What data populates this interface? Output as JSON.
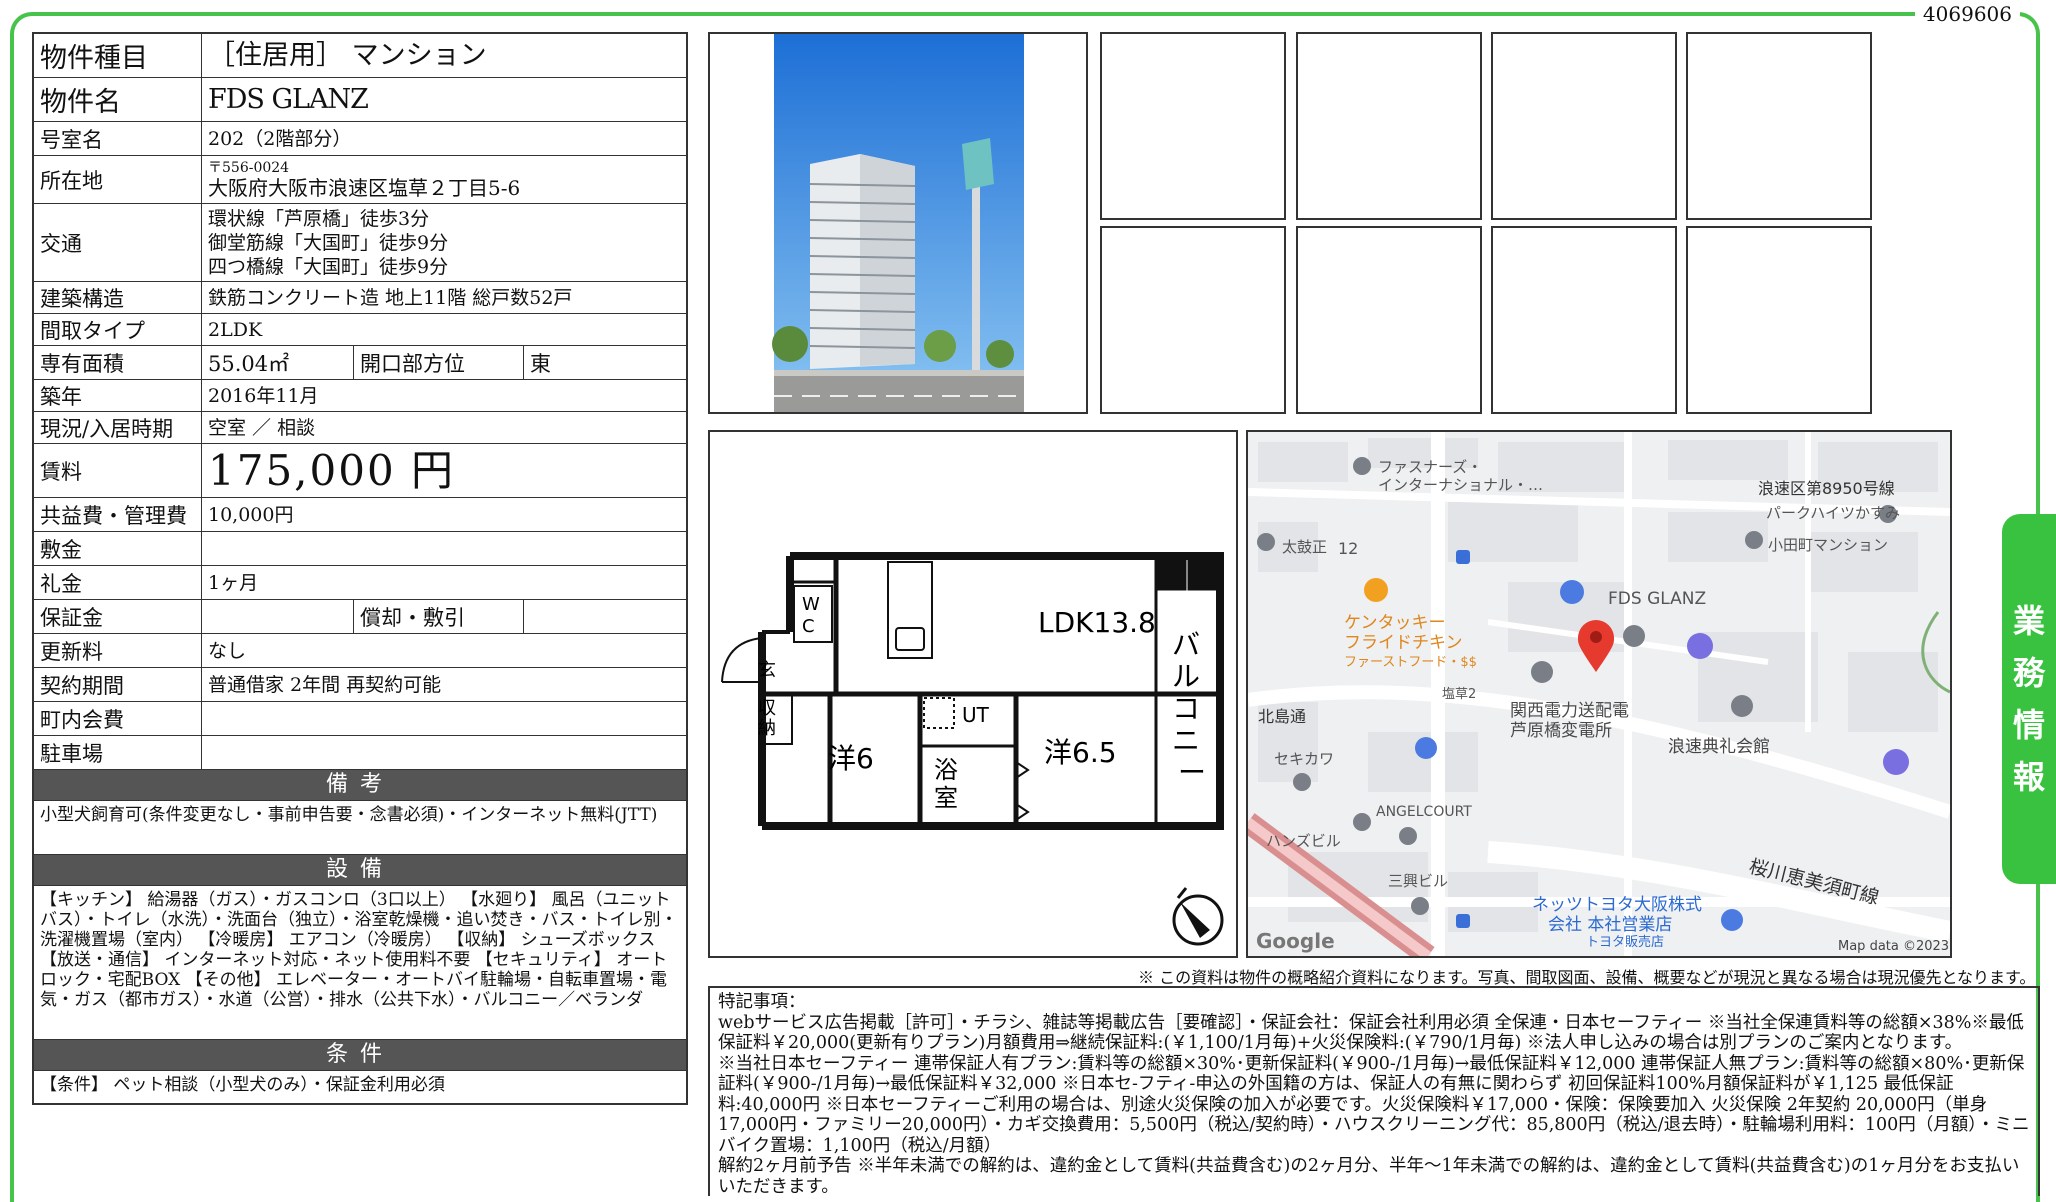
{
  "doc_id": "4069606",
  "side_tab": "業務情報",
  "property": {
    "rows": [
      {
        "label": "物件種目",
        "value": "［住居用］ マンション",
        "size": "big"
      },
      {
        "label": "物件名",
        "value": "FDS GLANZ",
        "size": "big"
      },
      {
        "label": "号室名",
        "value": "202（2階部分）"
      },
      {
        "label": "所在地",
        "postal": "〒556-0024",
        "value": "大阪府大阪市浪速区塩草２丁目5-6"
      },
      {
        "label": "交通",
        "lines": [
          "環状線「芦原橋」徒歩3分",
          "御堂筋線「大国町」徒歩9分",
          "四つ橋線「大国町」徒歩9分"
        ]
      },
      {
        "label": "建築構造",
        "value": "鉄筋コンクリート造 地上11階 総戸数52戸"
      },
      {
        "label": "間取タイプ",
        "value": "2LDK"
      },
      {
        "label": "専有面積",
        "value": "55.04㎡",
        "sub_label": "開口部方位",
        "sub_value": "東"
      },
      {
        "label": "築年",
        "value": "2016年11月"
      },
      {
        "label": "現況/入居時期",
        "value": "空室 ／ 相談"
      },
      {
        "label": "賃料",
        "value": "175,000 円",
        "size": "rent"
      },
      {
        "label": "共益費・管理費",
        "value": "10,000円"
      },
      {
        "label": "敷金",
        "value": ""
      },
      {
        "label": "礼金",
        "value": "1ヶ月"
      },
      {
        "label": "保証金",
        "value": "",
        "sub_label": "償却・敷引",
        "sub_value": ""
      },
      {
        "label": "更新料",
        "value": "なし"
      },
      {
        "label": "契約期間",
        "value": "普通借家 2年間 再契約可能"
      },
      {
        "label": "町内会費",
        "value": ""
      },
      {
        "label": "駐車場",
        "value": ""
      }
    ],
    "remarks_header": "備考",
    "remarks": "小型犬飼育可(条件変更なし・事前申告要・念書必須)・インターネット無料(JTT)",
    "equipment_header": "設備",
    "equipment": "【キッチン】 給湯器（ガス）・ガスコンロ（3口以上） 【水廻り】 風呂（ユニットバス）・トイレ（水洗）・洗面台（独立）・浴室乾燥機・追い焚き・バス・トイレ別・洗濯機置場（室内） 【冷暖房】 エアコン（冷暖房） 【収納】 シューズボックス 【放送・通信】 インターネット対応・ネット使用料不要 【セキュリティ】 オートロック・宅配BOX 【その他】 エレベーター・オートバイ駐輪場・自転車置場・電気・ガス（都市ガス）・水道（公営）・排水（公共下水）・バルコニー／ベランダ",
    "conditions_header": "条件",
    "conditions": "【条件】 ペット相談（小型犬のみ）・保証金利用必須"
  },
  "floorplan": {
    "ldk": "LDK13.8",
    "wc": [
      "W",
      "C"
    ],
    "entrance": "玄",
    "storage": [
      "収",
      "納"
    ],
    "room1": "洋6",
    "room2": "洋6.5",
    "ut": "UT",
    "bath": [
      "浴",
      "室"
    ],
    "balcony": [
      "バ",
      "ル",
      "コ",
      "ニ",
      "ー"
    ]
  },
  "map": {
    "labels": {
      "fastners": "ファスナーズ・",
      "fastners2": "インターナショナル・…",
      "road8950": "浪速区第8950号線",
      "parkheights": "パークハイツかすみ",
      "odamachi": "小田町マンション",
      "taikomasa": "太鼓正",
      "num12": "12",
      "fds": "FDS GLANZ",
      "kfc1": "ケンタッキー",
      "kfc2": "フライドチキン",
      "kfc3": "ファーストフード・$$",
      "shiokusa": "塩草2",
      "kansai1": "関西電力送配電",
      "kansai2": "芦原橋変電所",
      "kitajima": "北島通",
      "sekikawa": "セキカワ",
      "naniwa": "浪速典礼会館",
      "angel": "ANGELCOURT",
      "hanzu": "ハンズビル",
      "sanko": "三興ビル",
      "sakuragawa": "桜川恵美須町線",
      "netz1": "ネッツトヨタ大阪株式",
      "netz2": "会社 本社営業店",
      "netz3": "トヨタ販売店",
      "google": "Google",
      "mapdata": "Map data ©2023"
    }
  },
  "disclaimer": "※ この資料は物件の概略紹介資料になります。写真、間取図面、設備、概要などが現況と異なる場合は現況優先となります。",
  "notes": [
    "特記事項：",
    "webサービス広告掲載［許可］・チラシ、雑誌等掲載広告［要確認］・保証会社：保証会社利用必須 全保連・日本セーフティー ※当社全保連賃料等の総額×38%※最低保証料￥20,000(更新有りプラン)月額費用⇒継続保証料:(￥1,100/1月毎)+火災保険料:(￥790/1月毎) ※法人申し込みの場合は別プランのご案内となります。",
    "※当社日本セーフティー 連帯保証人有プラン:賃料等の総額×30%･更新保証料(￥900-/1月毎)→最低保証料￥12,000 連帯保証人無プラン:賃料等の総額×80%･更新保証料(￥900-/1月毎)→最低保証料￥32,000 ※日本セ-フティ-申込の外国籍の方は、保証人の有無に関わらず 初回保証料100%月額保証料が￥1,125 最低保証料:40,000円 ※日本セーフティーご利用の場合は、別途火災保険の加入が必要です。火災保険料￥17,000・保険：保険要加入 火災保険 2年契約 20,000円（単身17,000円・ファミリー20,000円）・カギ交換費用：5,500円（税込/契約時）・ハウスクリーニング代：85,800円（税込/退去時）・駐輪場利用料：100円（月額）・ミニバイク置場：1,100円（税込/月額）",
    "解約2ヶ月前予告 ※半年未満での解約は、違約金として賃料(共益費含む)の2ヶ月分、半年〜1年未満での解約は、違約金として賃料(共益費含む)の1ヶ月分をお支払いいただきます。"
  ]
}
